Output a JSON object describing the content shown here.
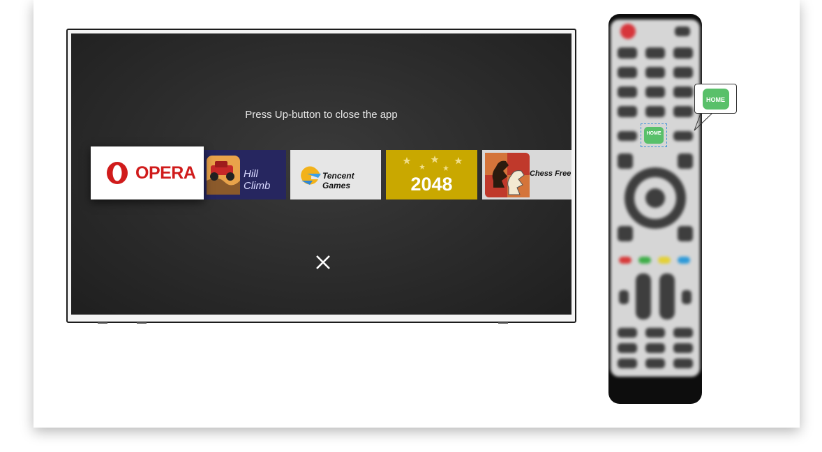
{
  "screen": {
    "hint_text": "Press Up-button to close the app",
    "apps": [
      {
        "label": "OPERA",
        "icon": "opera-logo",
        "focused": true
      },
      {
        "label": "Hill Climb",
        "icon": "hill-climb-icon",
        "focused": false
      },
      {
        "label": "Tencent Games",
        "icon": "tencent-logo",
        "focused": false
      },
      {
        "label": "2048",
        "icon": "2048-tile",
        "focused": false
      },
      {
        "label": "Chess Free",
        "icon": "chess-knight-icon",
        "focused": false
      }
    ],
    "close_icon": "close-x-icon"
  },
  "remote": {
    "home_label": "HOME",
    "callout_label": "HOME",
    "colors": {
      "home_green": "#59c06a",
      "power_red": "#d7353b",
      "key_red": "#d73a3a",
      "key_green": "#3fae49",
      "key_yellow": "#e4d137",
      "key_blue": "#2e9ad9"
    }
  }
}
